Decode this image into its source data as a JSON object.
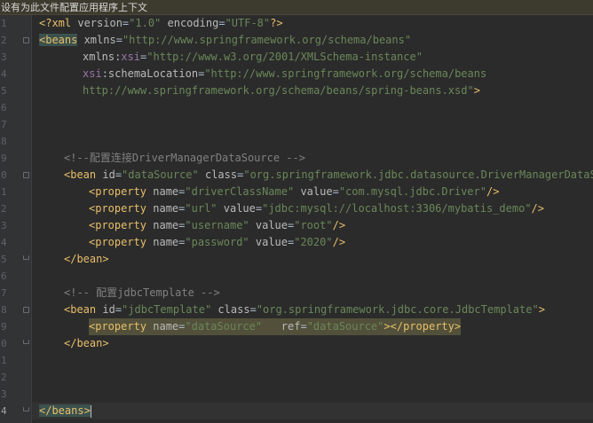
{
  "banner": {
    "text": "设有为此文件配置应用程序上下文"
  },
  "gutter": {
    "line_numbers": [
      "1",
      "2",
      "3",
      "4",
      "5",
      "6",
      "7",
      "8",
      "9",
      "0",
      "1",
      "2",
      "3",
      "4",
      "5",
      "6",
      "7",
      "8",
      "9",
      "0",
      "1",
      "2",
      "3",
      "4"
    ]
  },
  "code": {
    "l1_decl_open": "<?xml",
    "l1_attr_version": " version",
    "l1_eq1": "=",
    "l1_version_value": "\"1.0\"",
    "l1_attr_encoding": " encoding",
    "l1_eq2": "=",
    "l1_encoding_value": "\"UTF-8\"",
    "l1_decl_close": "?>",
    "l2_tag": "<beans",
    "l2_attr": " xmlns",
    "l2_eq": "=",
    "l2_value": "\"http://www.springframework.org/schema/beans\"",
    "l3_ns": "xmlns",
    "l3_colon": ":",
    "l3_attr": "xsi",
    "l3_eq": "=",
    "l3_value": "\"http://www.w3.org/2001/XMLSchema-instance\"",
    "l4_ns": "xsi",
    "l4_colon": ":",
    "l4_attr": "schemaLocation",
    "l4_eq": "=",
    "l4_value": "\"http://www.springframework.org/schema/beans",
    "l5_value": "http://www.springframework.org/schema/beans/spring-beans.xsd\"",
    "l5_close": ">",
    "l9_comment": "<!--配置连接DriverManagerDataSource -->",
    "l10_tag": "<bean",
    "l10_attr_id": " id",
    "l10_eq1": "=",
    "l10_id_value": "\"dataSource\"",
    "l10_attr_class": " class",
    "l10_eq2": "=",
    "l10_class_value": "\"org.springframework.jdbc.datasource.DriverManagerDataSource\"",
    "l10_close": ">",
    "l11_tag": "<property",
    "l11_attr_name": " name",
    "l11_eq1": "=",
    "l11_name_value": "\"driverClassName\"",
    "l11_attr_value": " value",
    "l11_eq2": "=",
    "l11_value_value": "\"com.mysql.jdbc.Driver\"",
    "l11_close": "/>",
    "l12_tag": "<property",
    "l12_attr_name": " name",
    "l12_eq1": "=",
    "l12_name_value": "\"url\"",
    "l12_attr_value": " value",
    "l12_eq2": "=",
    "l12_value_value": "\"jdbc:mysql://localhost:3306/mybatis_demo\"",
    "l12_close": "/>",
    "l13_tag": "<property",
    "l13_attr_name": " name",
    "l13_eq1": "=",
    "l13_name_value": "\"username\"",
    "l13_attr_value": " value",
    "l13_eq2": "=",
    "l13_value_value": "\"root\"",
    "l13_close": "/>",
    "l14_tag": "<property",
    "l14_attr_name": " name",
    "l14_eq1": "=",
    "l14_name_value": "\"password\"",
    "l14_attr_value": " value",
    "l14_eq2": "=",
    "l14_value_value": "\"2020\"",
    "l14_close": "/>",
    "l15_tag": "</bean>",
    "l17_comment": "<!-- 配置jdbcTemplate -->",
    "l18_tag": "<bean",
    "l18_attr_id": " id",
    "l18_eq1": "=",
    "l18_id_value": "\"jdbcTemplate\"",
    "l18_attr_class": " class",
    "l18_eq2": "=",
    "l18_class_value": "\"org.springframework.jdbc.core.JdbcTemplate\"",
    "l18_close": ">",
    "l19_tag": "<property",
    "l19_attr_name": " name",
    "l19_eq1": "=",
    "l19_name_value": "\"dataSource\"",
    "l19_attr_ref": "   ref",
    "l19_eq2": "=",
    "l19_ref_value": "\"dataSource\"",
    "l19_close": "></property>",
    "l20_tag": "</bean>",
    "l24_tag": "</beans>"
  },
  "colors": {
    "editor_background": "#2b2b2b",
    "gutter_background": "#313335",
    "banner_background": "#3d3a2e",
    "tag": "#e8bf6a",
    "attribute": "#bababa",
    "namespace": "#9876aa",
    "string": "#6a8759",
    "comment": "#808080",
    "tag_match_highlight": "#3b514d",
    "element_highlight": "#52503a"
  },
  "icons": {
    "fold_marker": "fold-marker-icon",
    "caret": "text-caret-icon"
  }
}
